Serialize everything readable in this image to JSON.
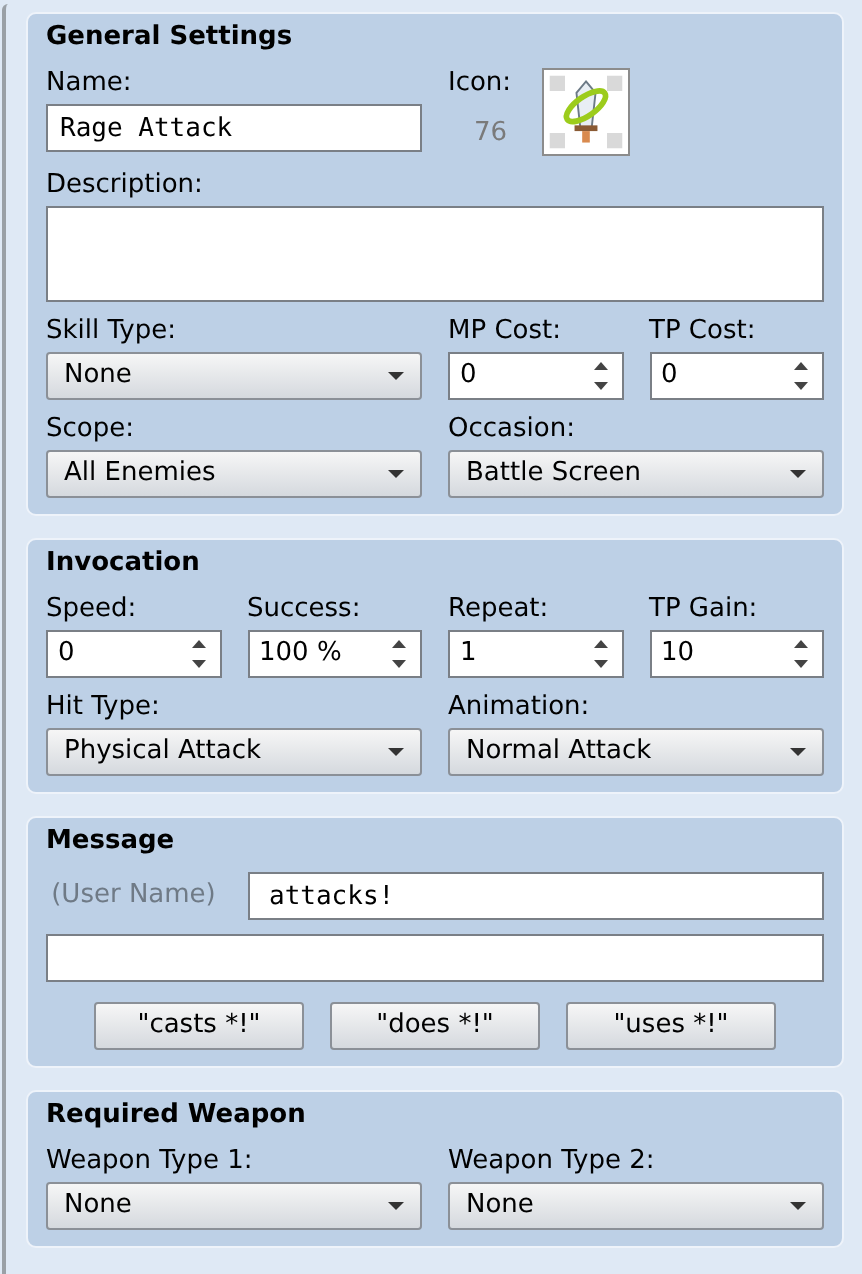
{
  "sections": [
    {
      "title": "General Settings",
      "rows": [
        {
          "fields": [
            {
              "kind": "text",
              "label": "Name:",
              "value": "Rage Attack"
            },
            {
              "kind": "icon",
              "label": "Icon:",
              "value": "76"
            }
          ]
        },
        {
          "fields": [
            {
              "kind": "textarea",
              "label": "Description:"
            }
          ]
        },
        {
          "fields": [
            {
              "kind": "select",
              "label": "Skill Type:",
              "value": "None"
            },
            {
              "kind": "spin",
              "label": "MP Cost:",
              "value": "0"
            },
            {
              "kind": "spin",
              "label": "TP Cost:",
              "value": "0"
            }
          ]
        },
        {
          "fields": [
            {
              "kind": "select",
              "label": "Scope:",
              "value": "All Enemies"
            },
            {
              "kind": "select",
              "label": "Occasion:",
              "value": "Battle Screen"
            }
          ]
        }
      ]
    },
    {
      "title": "Invocation",
      "rows": [
        {
          "fields": [
            {
              "kind": "spin",
              "label": "Speed:",
              "value": "0"
            },
            {
              "kind": "spin",
              "label": "Success:",
              "value": "100 %"
            },
            {
              "kind": "spin",
              "label": "Repeat:",
              "value": "1"
            },
            {
              "kind": "spin",
              "label": "TP Gain:",
              "value": "10"
            }
          ]
        },
        {
          "fields": [
            {
              "kind": "select",
              "label": "Hit Type:",
              "value": "Physical Attack"
            },
            {
              "kind": "select",
              "label": "Animation:",
              "value": "Normal Attack"
            }
          ]
        }
      ]
    },
    {
      "title": "Message",
      "rows": [
        {
          "fields": [
            {
              "kind": "inline_text",
              "label": "(User Name)",
              "value": "attacks!"
            }
          ]
        },
        {
          "fields": [
            {
              "kind": "wide_text"
            }
          ]
        },
        {
          "fields": [
            {
              "kind": "buttons",
              "buttons": [
                "\"casts *!\"",
                "\"does *!\"",
                "\"uses *!\""
              ]
            }
          ]
        }
      ]
    },
    {
      "title": "Required Weapon",
      "rows": [
        {
          "fields": [
            {
              "kind": "select",
              "label": "Weapon Type 1:",
              "value": "None"
            },
            {
              "kind": "select",
              "label": "Weapon Type 2:",
              "value": "None"
            }
          ]
        }
      ]
    }
  ]
}
